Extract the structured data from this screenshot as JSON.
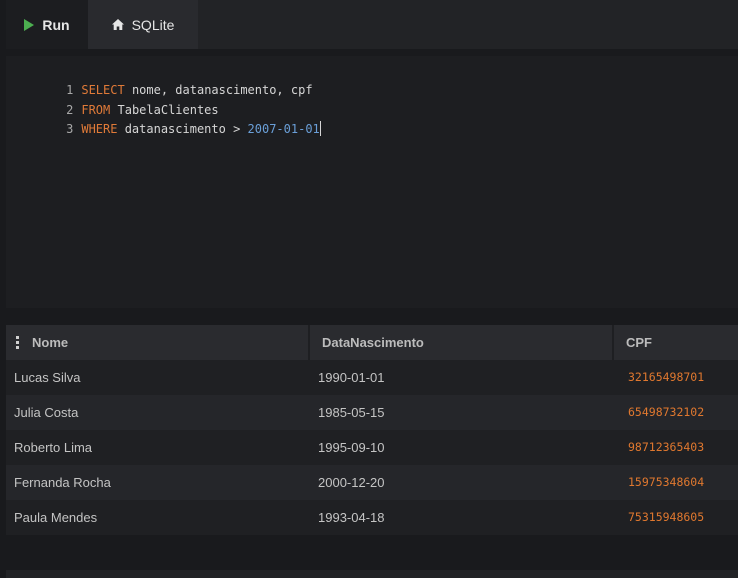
{
  "toolbar": {
    "run_label": "Run",
    "db_label": "SQLite",
    "run_icon_color": "#4caf50"
  },
  "editor": {
    "lines": [
      {
        "number": "1",
        "tokens": [
          {
            "text": "SELECT",
            "kind": "keyword"
          },
          {
            "text": " nome, datanascimento, cpf",
            "kind": "identifier"
          }
        ]
      },
      {
        "number": "2",
        "tokens": [
          {
            "text": "FROM",
            "kind": "keyword"
          },
          {
            "text": " TabelaClientes",
            "kind": "identifier"
          }
        ]
      },
      {
        "number": "3",
        "tokens": [
          {
            "text": "WHERE",
            "kind": "keyword"
          },
          {
            "text": " datanascimento > ",
            "kind": "identifier"
          },
          {
            "text": "2007-01-01",
            "kind": "literal"
          }
        ]
      }
    ]
  },
  "results": {
    "columns": [
      "Nome",
      "DataNascimento",
      "CPF"
    ],
    "rows": [
      [
        "Lucas Silva",
        "1990-01-01",
        "32165498701"
      ],
      [
        "Julia Costa",
        "1985-05-15",
        "65498732102"
      ],
      [
        "Roberto Lima",
        "1995-09-10",
        "98712365403"
      ],
      [
        "Fernanda Rocha",
        "2000-12-20",
        "15975348604"
      ],
      [
        "Paula Mendes",
        "1993-04-18",
        "75315948605"
      ]
    ]
  },
  "colors": {
    "background": "#191a1d",
    "keyword": "#e07a38",
    "literal": "#6a9fd8",
    "cpf": "#e0782f"
  }
}
